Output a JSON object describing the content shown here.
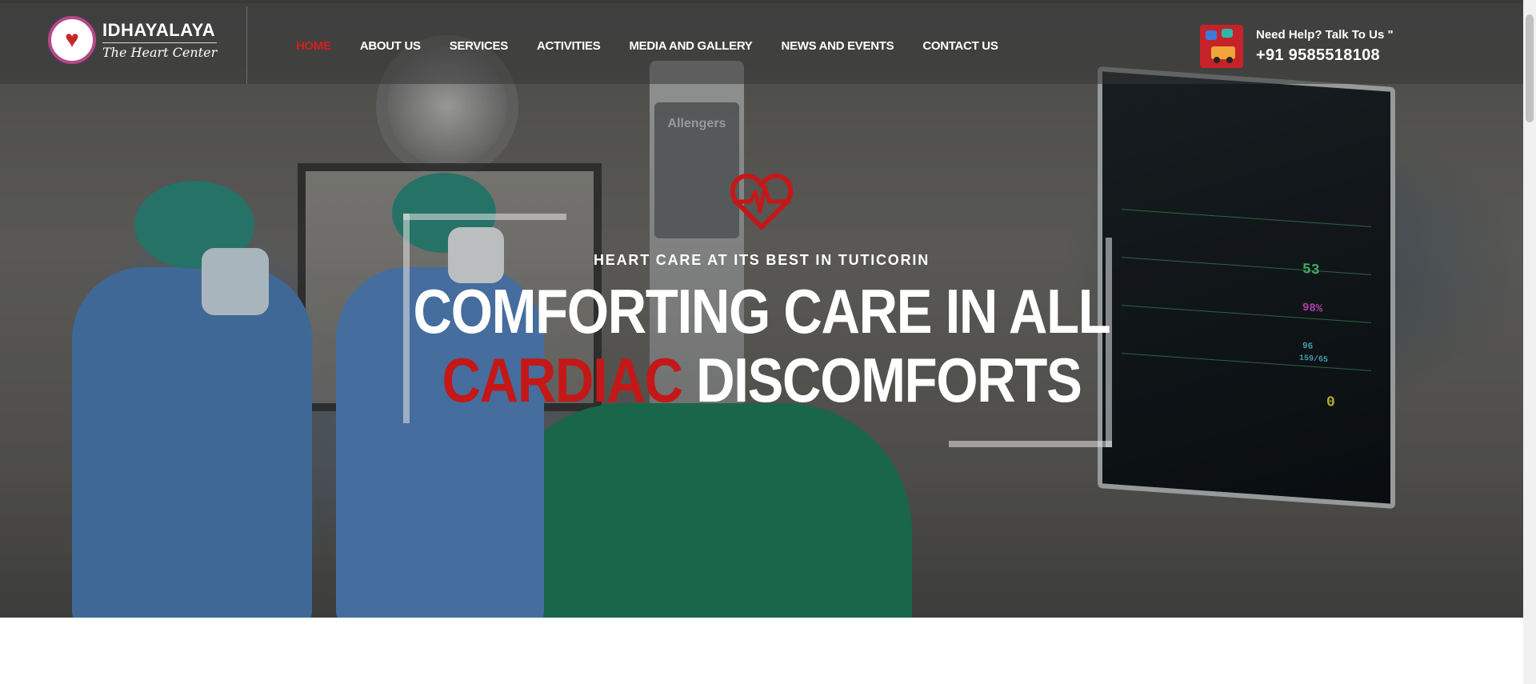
{
  "header": {
    "logo_name": "IDHAYALAYA",
    "logo_tagline": "The Heart Center",
    "nav": [
      {
        "label": "HOME",
        "active": true
      },
      {
        "label": "ABOUT US",
        "active": false
      },
      {
        "label": "SERVICES",
        "active": false
      },
      {
        "label": "ACTIVITIES",
        "active": false
      },
      {
        "label": "MEDIA AND GALLERY",
        "active": false
      },
      {
        "label": "NEWS AND EVENTS",
        "active": false
      },
      {
        "label": "CONTACT US",
        "active": false
      }
    ],
    "help": {
      "title": "Need Help? Talk To Us \"",
      "phone": "+91 9585518108",
      "icon": "ambulance-chat-icon"
    }
  },
  "hero": {
    "icon": "heartbeat-icon",
    "tagline": "HEART CARE AT ITS BEST IN TUTICORIN",
    "headline_line1": "COMFORTING CARE IN ALL",
    "headline_accent": "CARDIAC",
    "headline_rest": "DISCOMFORTS",
    "background_brand": "Allengers",
    "monitor_vitals": [
      "53",
      "98%",
      "96",
      "159/65",
      "0"
    ]
  },
  "colors": {
    "accent": "#c41818",
    "nav_active": "#d32020",
    "logo_ring": "#b5478c",
    "help_icon_bg": "#c6222a"
  }
}
